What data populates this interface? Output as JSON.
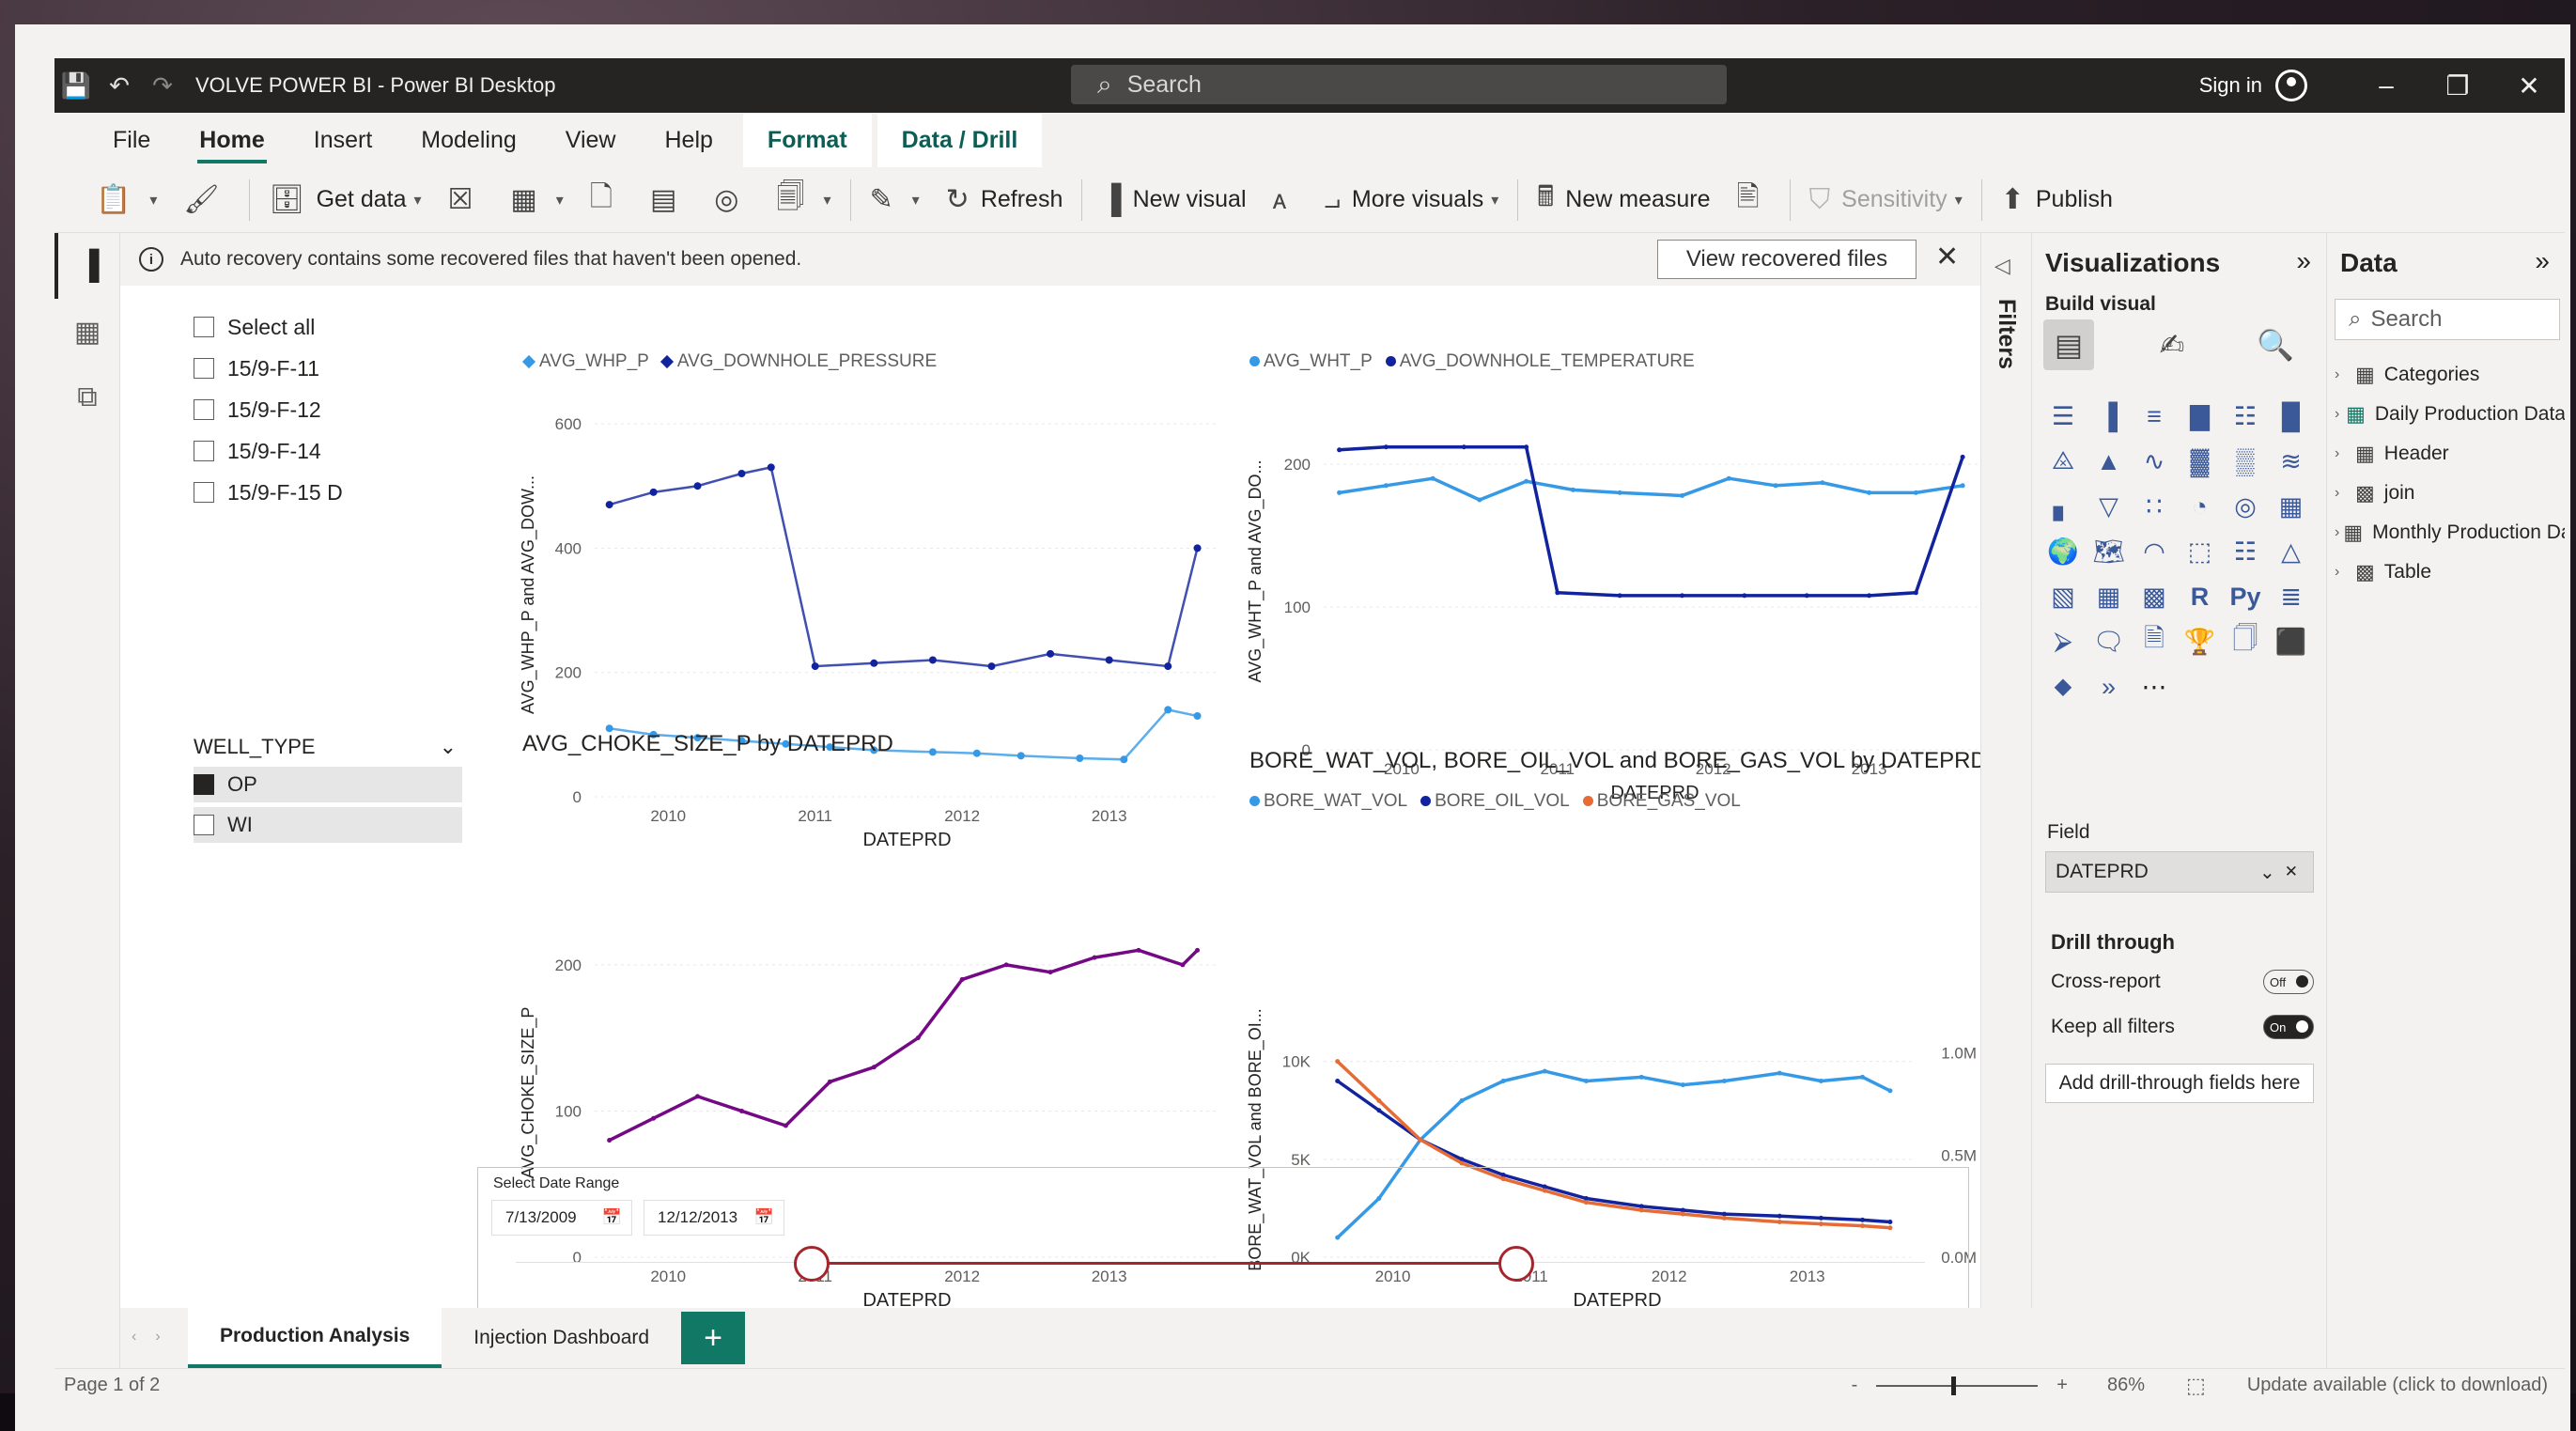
{
  "app": {
    "window_title": "VOLVE POWER BI - Power BI Desktop",
    "search_placeholder": "Search",
    "sign_in": "Sign in"
  },
  "menu": {
    "tabs": [
      "File",
      "Home",
      "Insert",
      "Modeling",
      "View",
      "Help",
      "Format",
      "Data / Drill"
    ],
    "active": "Home"
  },
  "ribbon": {
    "get_data": "Get data",
    "refresh": "Refresh",
    "new_visual": "New visual",
    "more_visuals": "More visuals",
    "new_measure": "New measure",
    "sensitivity": "Sensitivity",
    "publish": "Publish"
  },
  "notice": {
    "text": "Auto recovery contains some recovered files that haven't been opened.",
    "button": "View recovered files"
  },
  "slicer_wells": {
    "items": [
      "Select all",
      "15/9-F-11",
      "15/9-F-12",
      "15/9-F-14",
      "15/9-F-15 D"
    ]
  },
  "slicer_type": {
    "title": "WELL_TYPE",
    "items": [
      {
        "label": "OP",
        "checked": true
      },
      {
        "label": "WI",
        "checked": false
      }
    ]
  },
  "date_range": {
    "label": "Select Date Range",
    "start": "7/13/2009",
    "end": "12/12/2013",
    "range_fraction": [
      0.21,
      0.71
    ]
  },
  "chart_data": [
    {
      "type": "scatter",
      "title": "",
      "legend": [
        "AVG_WHP_P",
        "AVG_DOWNHOLE_PRESSURE"
      ],
      "xlabel": "DATEPRD",
      "ylabel": "AVG_WHP_P and AVG_DOW...",
      "x_ticks": [
        "2010",
        "2011",
        "2012",
        "2013"
      ],
      "y_ticks": [
        "0",
        "200",
        "400",
        "600"
      ],
      "ylim": [
        0,
        650
      ],
      "series": [
        {
          "name": "AVG_WHP_P",
          "color": "#3599e6",
          "x": [
            2009.6,
            2009.9,
            2010.2,
            2010.5,
            2010.8,
            2011.1,
            2011.4,
            2011.8,
            2012.1,
            2012.4,
            2012.8,
            2013.1,
            2013.4,
            2013.6
          ],
          "y": [
            110,
            100,
            95,
            90,
            85,
            80,
            75,
            72,
            70,
            66,
            62,
            60,
            140,
            130
          ]
        },
        {
          "name": "AVG_DOWNHOLE_PRESSURE",
          "color": "#12239e",
          "x": [
            2009.6,
            2009.9,
            2010.2,
            2010.5,
            2010.7,
            2011.0,
            2011.4,
            2011.8,
            2012.2,
            2012.6,
            2013.0,
            2013.4,
            2013.6
          ],
          "y": [
            470,
            490,
            500,
            520,
            530,
            210,
            215,
            220,
            210,
            230,
            220,
            210,
            400
          ]
        }
      ]
    },
    {
      "type": "line",
      "title": "",
      "legend": [
        "AVG_WHT_P",
        "AVG_DOWNHOLE_TEMPERATURE"
      ],
      "xlabel": "DATEPRD",
      "ylabel": "AVG_WHT_P and AVG_DO...",
      "x_ticks": [
        "2010",
        "2011",
        "2012",
        "2013"
      ],
      "y_ticks": [
        "0",
        "100",
        "200"
      ],
      "ylim": [
        0,
        250
      ],
      "series": [
        {
          "name": "AVG_WHT_P",
          "color": "#3599e6",
          "x": [
            2009.6,
            2009.9,
            2010.2,
            2010.5,
            2010.8,
            2011.1,
            2011.4,
            2011.8,
            2012.1,
            2012.4,
            2012.7,
            2013.0,
            2013.3,
            2013.6
          ],
          "y": [
            180,
            185,
            190,
            175,
            188,
            182,
            180,
            178,
            190,
            185,
            187,
            180,
            180,
            185
          ]
        },
        {
          "name": "AVG_DOWNHOLE_TEMPERATURE",
          "color": "#12239e",
          "x": [
            2009.6,
            2009.9,
            2010.4,
            2010.8,
            2011.0,
            2011.4,
            2011.8,
            2012.2,
            2012.6,
            2013.0,
            2013.3,
            2013.6
          ],
          "y": [
            210,
            212,
            212,
            212,
            110,
            108,
            108,
            108,
            108,
            108,
            110,
            205
          ]
        }
      ]
    },
    {
      "type": "line",
      "title": "AVG_CHOKE_SIZE_P by DATEPRD",
      "xlabel": "DATEPRD",
      "ylabel": "AVG_CHOKE_SIZE_P",
      "x_ticks": [
        "2010",
        "2011",
        "2012",
        "2013"
      ],
      "y_ticks": [
        "0",
        "100",
        "200"
      ],
      "ylim": [
        0,
        225
      ],
      "series": [
        {
          "name": "AVG_CHOKE_SIZE_P",
          "color": "#750985",
          "x": [
            2009.6,
            2009.9,
            2010.2,
            2010.5,
            2010.8,
            2011.1,
            2011.4,
            2011.7,
            2012.0,
            2012.3,
            2012.6,
            2012.9,
            2013.2,
            2013.5,
            2013.6
          ],
          "y": [
            80,
            95,
            110,
            100,
            90,
            120,
            130,
            150,
            190,
            200,
            195,
            205,
            210,
            200,
            210
          ]
        }
      ]
    },
    {
      "type": "line",
      "title": "BORE_WAT_VOL, BORE_OIL_VOL and BORE_GAS_VOL by DATEPRD",
      "legend": [
        "BORE_WAT_VOL",
        "BORE_OIL_VOL",
        "BORE_GAS_VOL"
      ],
      "xlabel": "DATEPRD",
      "ylabel": "BORE_WAT_VOL and BORE_OI...",
      "y2label": "BORE_GAS_VOL",
      "x_ticks": [
        "2010",
        "2011",
        "2012",
        "2013"
      ],
      "y_ticks": [
        "0K",
        "5K",
        "10K"
      ],
      "y2_ticks": [
        "0.0M",
        "0.5M",
        "1.0M"
      ],
      "ylim": [
        0,
        12000
      ],
      "series": [
        {
          "name": "BORE_WAT_VOL",
          "color": "#3599e6",
          "x": [
            2009.6,
            2009.9,
            2010.2,
            2010.5,
            2010.8,
            2011.1,
            2011.4,
            2011.8,
            2012.1,
            2012.4,
            2012.8,
            2013.1,
            2013.4,
            2013.6
          ],
          "y": [
            1000,
            3000,
            6000,
            8000,
            9000,
            9500,
            9000,
            9200,
            8800,
            9000,
            9400,
            9000,
            9200,
            8500
          ]
        },
        {
          "name": "BORE_OIL_VOL",
          "color": "#12239e",
          "x": [
            2009.6,
            2009.9,
            2010.2,
            2010.5,
            2010.8,
            2011.1,
            2011.4,
            2011.8,
            2012.1,
            2012.4,
            2012.8,
            2013.1,
            2013.4,
            2013.6
          ],
          "y": [
            9000,
            7500,
            6000,
            5000,
            4200,
            3600,
            3000,
            2600,
            2400,
            2200,
            2100,
            2000,
            1900,
            1800
          ]
        },
        {
          "name": "BORE_GAS_VOL",
          "color": "#e66c37",
          "x": [
            2009.6,
            2009.9,
            2010.2,
            2010.5,
            2010.8,
            2011.1,
            2011.4,
            2011.8,
            2012.1,
            2012.4,
            2012.8,
            2013.1,
            2013.4,
            2013.6
          ],
          "y": [
            10000,
            8000,
            6000,
            4800,
            4000,
            3400,
            2800,
            2400,
            2200,
            2000,
            1800,
            1700,
            1600,
            1500
          ]
        }
      ]
    }
  ],
  "pages": {
    "tabs": [
      "Production Analysis",
      "Injection Dashboard"
    ],
    "active": "Production Analysis",
    "add": "+"
  },
  "status": {
    "page": "Page 1 of 2",
    "zoom": "86%",
    "zoom_minus": "-",
    "zoom_plus": "+",
    "update": "Update available (click to download)"
  },
  "filters_pane": {
    "label": "Filters"
  },
  "visualizations": {
    "title": "Visualizations",
    "build_visual": "Build visual",
    "field_label": "Field",
    "field_value": "DATEPRD",
    "drill_through": "Drill through",
    "cross_report": "Cross-report",
    "cross_report_state": "Off",
    "keep_all_filters": "Keep all filters",
    "keep_all_filters_state": "On",
    "add_drill": "Add drill-through fields here"
  },
  "data_pane": {
    "title": "Data",
    "search_placeholder": "Search",
    "tables": [
      "Categories",
      "Daily Production Data",
      "Header",
      "join",
      "Monthly Production Data",
      "Table"
    ]
  },
  "colors": {
    "accent": "#117865",
    "blue": "#3599e6",
    "navy": "#12239e",
    "purple": "#750985",
    "orange": "#e66c37"
  }
}
